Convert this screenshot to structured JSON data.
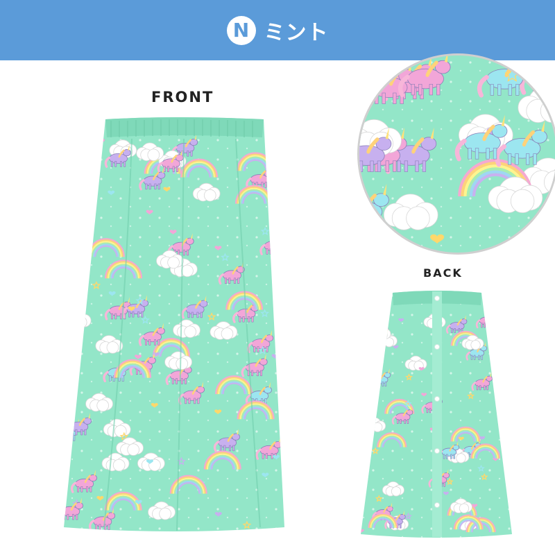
{
  "header": {
    "badge_letter": "N",
    "title": "ミント",
    "color": "#5b9bd9"
  },
  "views": {
    "front_label": "FRONT",
    "back_label": "BACK"
  },
  "product": {
    "fabric_color": "#93e6c8",
    "pattern_icons": [
      "unicorn-icon",
      "rainbow-icon",
      "cloud-icon",
      "heart-icon",
      "star-icon"
    ],
    "pattern_colors": [
      "#f2a6d8",
      "#c7b0ef",
      "#9ce6f0",
      "#ffffff",
      "#ffd86b"
    ]
  }
}
